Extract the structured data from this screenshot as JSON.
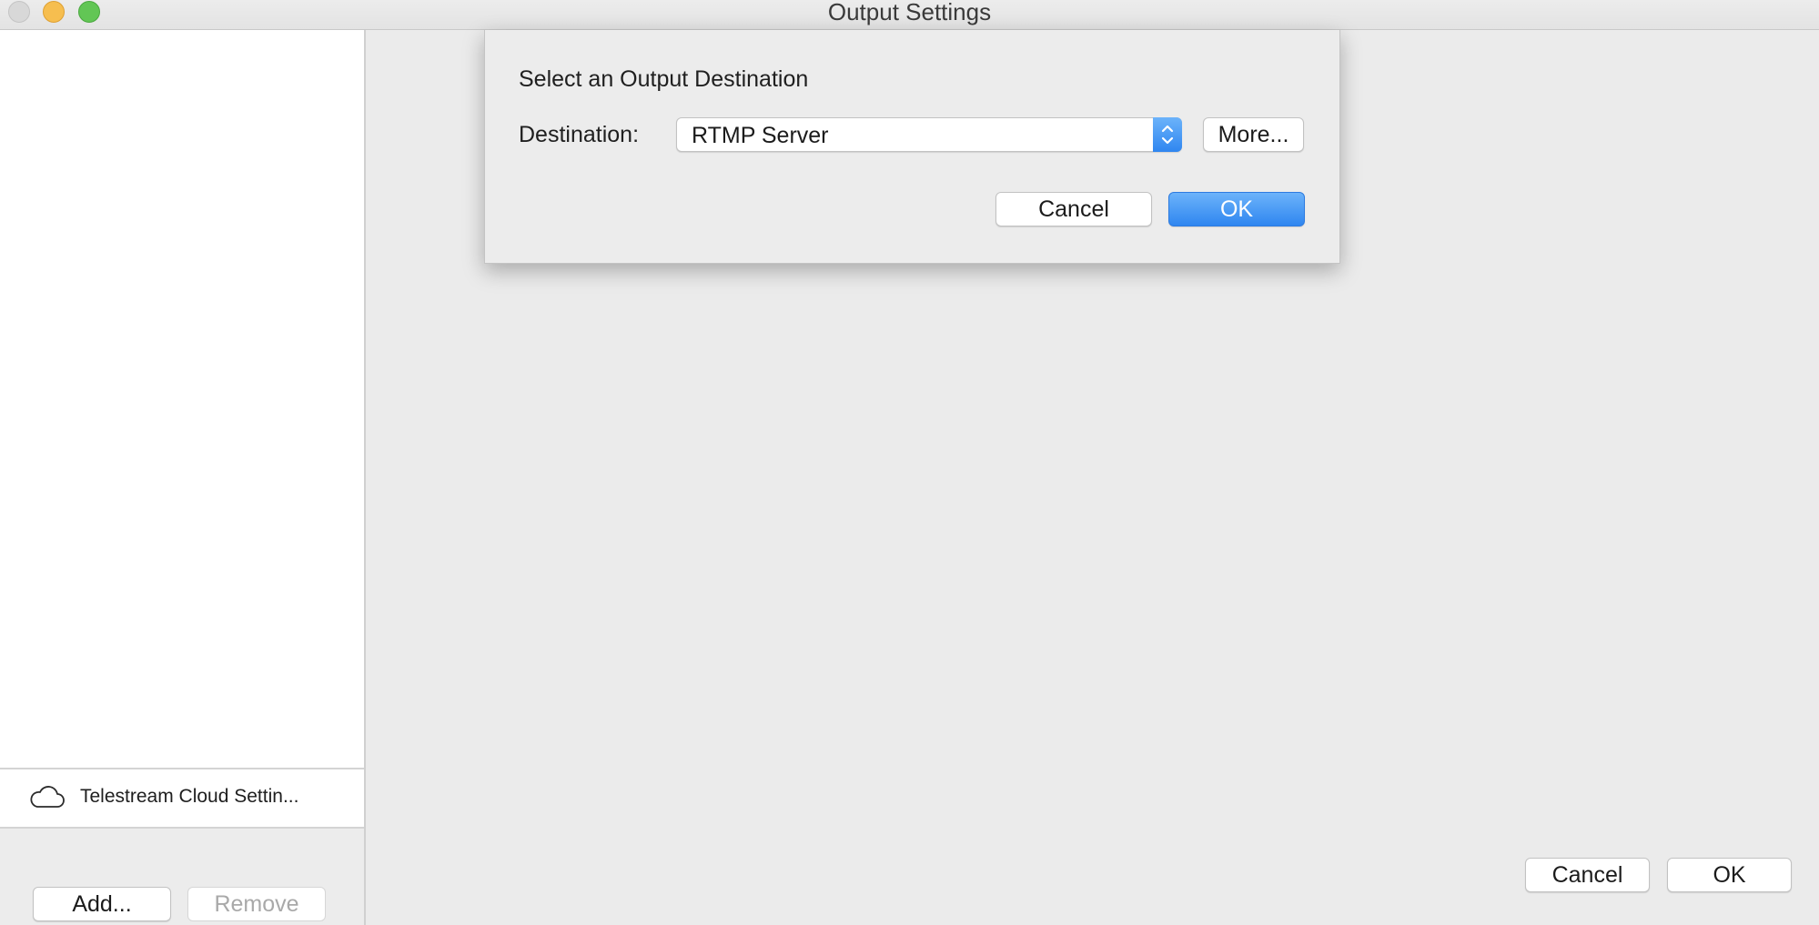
{
  "window": {
    "title": "Output Settings"
  },
  "sidebar": {
    "cloud_item": {
      "label": "Telestream Cloud Settin...",
      "icon": "cloud-icon"
    },
    "add_label": "Add...",
    "remove_label": "Remove"
  },
  "dialog": {
    "heading": "Select an Output Destination",
    "destination_label": "Destination:",
    "destination_value": "RTMP Server",
    "more_label": "More...",
    "cancel_label": "Cancel",
    "ok_label": "OK"
  },
  "footer": {
    "cancel_label": "Cancel",
    "ok_label": "OK"
  },
  "colors": {
    "accent": "#3b8ef3",
    "close": "#d8d8d8",
    "minimize": "#f6be4f",
    "maximize": "#62c655"
  }
}
